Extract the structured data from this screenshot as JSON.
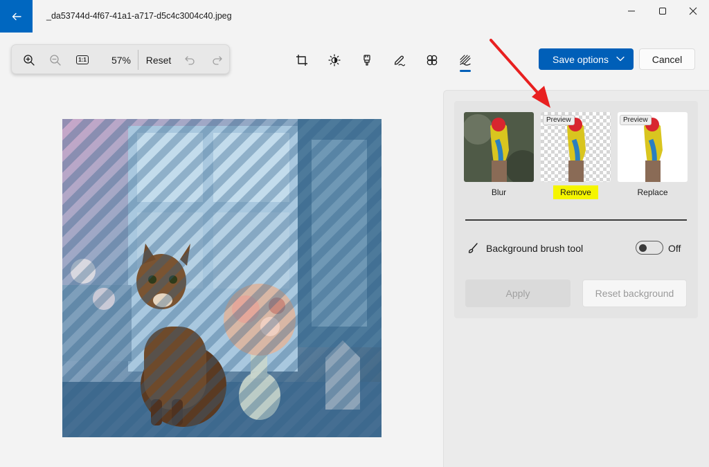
{
  "window": {
    "title": "_da53744d-4f67-41a1-a717-d5c4c3004c40.jpeg",
    "back_icon": "arrow-left-icon",
    "minimize_icon": "minimize-icon",
    "maximize_icon": "maximize-icon",
    "close_icon": "close-icon",
    "accent_color": "#0067c0"
  },
  "zoom_toolbar": {
    "zoom_in_icon": "zoom-in-icon",
    "zoom_out_icon": "zoom-out-icon",
    "actual_size_icon": "actual-size-icon",
    "actual_size_label": "1:1",
    "zoom_level": "57%",
    "reset_label": "Reset",
    "undo_icon": "undo-icon",
    "redo_icon": "redo-icon"
  },
  "edit_tools": [
    {
      "name": "crop",
      "icon": "crop-icon"
    },
    {
      "name": "adjustment",
      "icon": "brightness-icon"
    },
    {
      "name": "erase",
      "icon": "eraser-icon"
    },
    {
      "name": "markup",
      "icon": "pen-icon"
    },
    {
      "name": "filter",
      "icon": "filter-icon"
    },
    {
      "name": "background",
      "icon": "background-icon",
      "active": true
    }
  ],
  "actions": {
    "save_label": "Save options",
    "cancel_label": "Cancel",
    "save_color": "#005fb8"
  },
  "background_panel": {
    "options": [
      {
        "label": "Blur",
        "badge": ""
      },
      {
        "label": "Remove",
        "badge": "Preview",
        "highlight_color": "#f5f500"
      },
      {
        "label": "Replace",
        "badge": "Preview"
      }
    ],
    "brush_label": "Background brush tool",
    "brush_icon": "brush-icon",
    "brush_toggle_state": "Off",
    "apply_label": "Apply",
    "reset_background_label": "Reset background"
  },
  "annotation": {
    "arrow_color": "#e82020"
  }
}
